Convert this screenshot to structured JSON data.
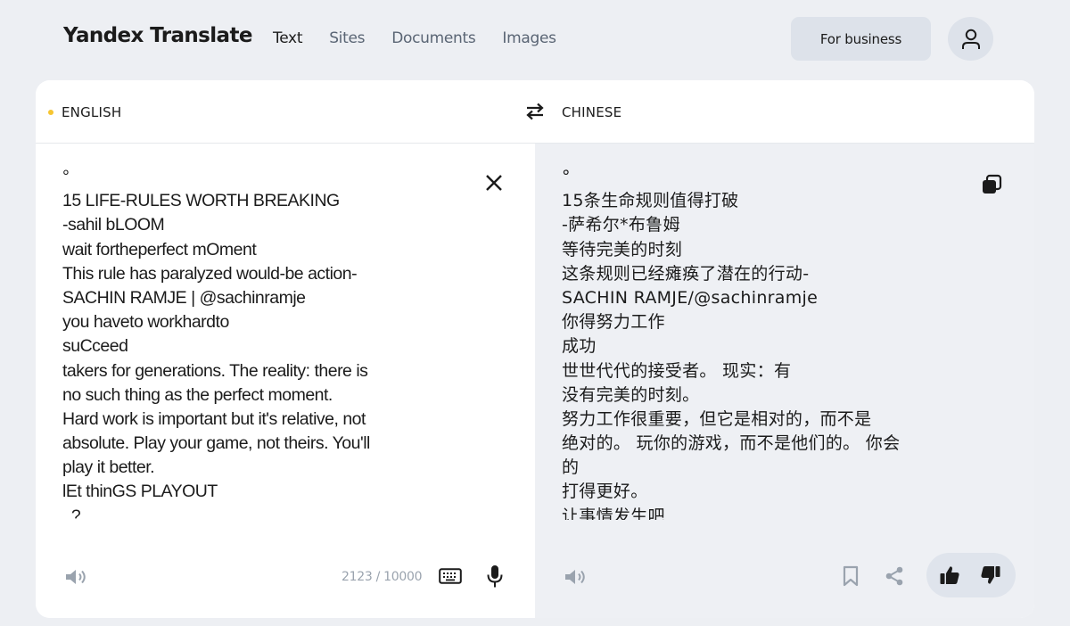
{
  "header": {
    "logo": "Yandex Translate",
    "nav": [
      {
        "label": "Text",
        "active": true
      },
      {
        "label": "Sites",
        "active": false
      },
      {
        "label": "Documents",
        "active": false
      },
      {
        "label": "Images",
        "active": false
      }
    ],
    "business_button": "For business",
    "user_icon": "user-icon"
  },
  "languages": {
    "source": "ENGLISH",
    "target": "CHINESE",
    "source_dot_color": "#f6c531"
  },
  "source": {
    "lines": [
      "°",
      "15 LIFE-RULES WORTH BREAKING",
      "-sahil bLOOM",
      "wait fortheperfect mOment",
      "This rule has paralyzed would-be action-",
      "SACHIN RAMJE | @sachinramje",
      "you haveto workhardto",
      "suCceed",
      "takers for generations. The reality: there is",
      "no such thing as the perfect moment.",
      "Hard work is important but it's relative, not",
      "absolute. Play your game, not theirs. You'll",
      "play it better.",
      "lEt thinGS PLAYOUT",
      "  ?"
    ],
    "counter": "2123 / 10000"
  },
  "target": {
    "lines": [
      "°",
      "15条生命规则值得打破",
      "-萨希尔*布鲁姆",
      "等待完美的时刻",
      "这条规则已经瘫痪了潜在的行动-",
      "SACHIN RAMJE/@sachinramje",
      "你得努力工作",
      "成功",
      "世世代代的接受者。 现实：有",
      "没有完美的时刻。",
      "努力工作很重要，但它是相对的，而不是",
      "绝对的。 玩你的游戏，而不是他们的。 你会",
      "的",
      "打得更好。",
      "让事情发生吧"
    ]
  },
  "colors": {
    "background": "#edeff3",
    "target_pane": "#eef0f4",
    "button_bg": "#dde2ea",
    "icon_gray": "#9aa3ae",
    "icon_dark": "#1b1b1b"
  }
}
